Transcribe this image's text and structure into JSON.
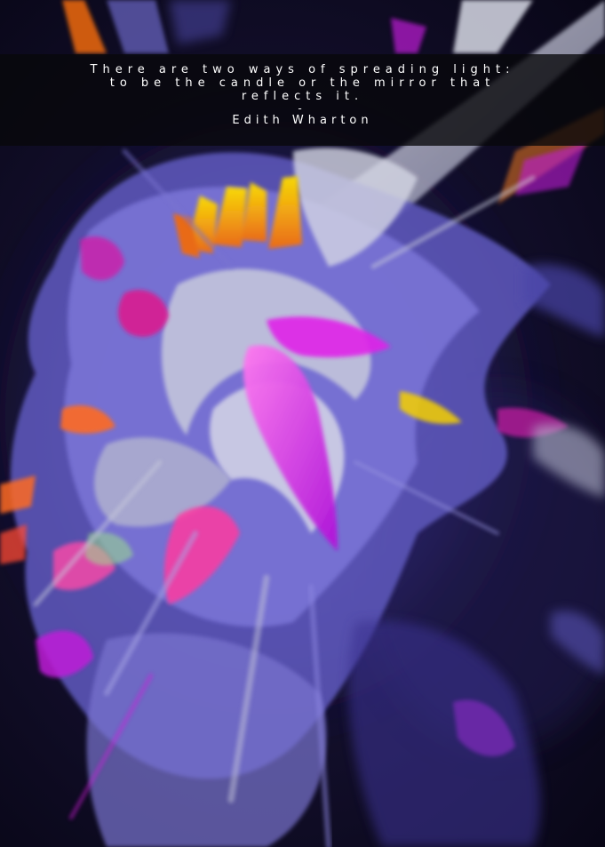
{
  "quote": {
    "line1": "There are two ways of spreading light:",
    "line2": "to be the candle or the mirror that",
    "line3": "reflects it.",
    "separator": "-",
    "author": "Edith Wharton"
  },
  "colors": {
    "background": "#0a0818",
    "quote_bar": "#08080a",
    "periwinkle": "#7f7ad6",
    "magenta": "#d21ce0",
    "violet": "#8a2be2",
    "silver": "#c9cbd8",
    "yellow": "#f5c400",
    "orange": "#f0701a",
    "pink": "#ff4aa8"
  }
}
